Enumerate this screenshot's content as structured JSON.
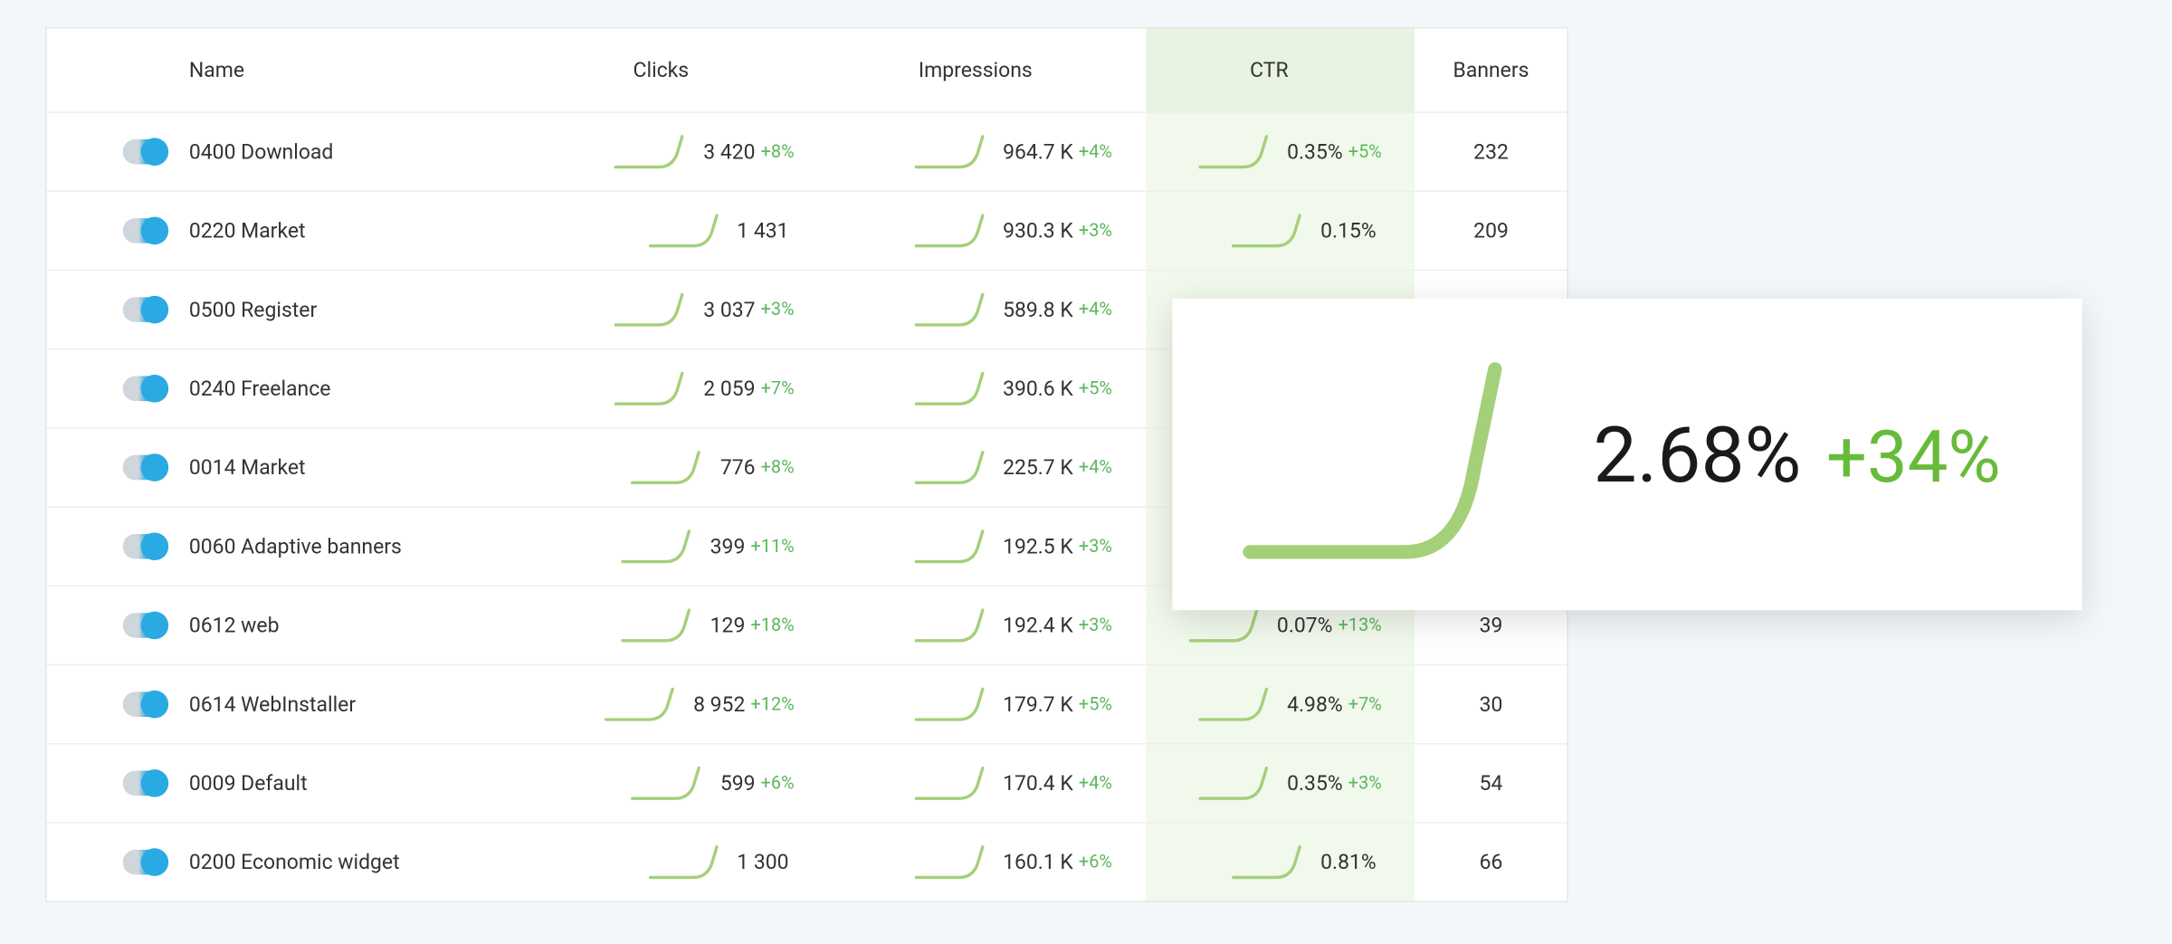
{
  "columns": {
    "name": "Name",
    "clicks": "Clicks",
    "impressions": "Impressions",
    "ctr": "CTR",
    "banners": "Banners"
  },
  "rows": [
    {
      "name": "0400 Download",
      "clicks": "3 420",
      "clicks_d": "+8%",
      "impr": "964.7 K",
      "impr_d": "+4%",
      "ctr": "0.35%",
      "ctr_d": "+5%",
      "banners": "232"
    },
    {
      "name": "0220 Market",
      "clicks": "1 431",
      "clicks_d": "",
      "impr": "930.3 K",
      "impr_d": "+3%",
      "ctr": "0.15%",
      "ctr_d": "",
      "banners": "209"
    },
    {
      "name": "0500 Register",
      "clicks": "3 037",
      "clicks_d": "+3%",
      "impr": "589.8 K",
      "impr_d": "+4%",
      "ctr": "",
      "ctr_d": "",
      "banners": ""
    },
    {
      "name": "0240 Freelance",
      "clicks": "2 059",
      "clicks_d": "+7%",
      "impr": "390.6 K",
      "impr_d": "+5%",
      "ctr": "",
      "ctr_d": "",
      "banners": ""
    },
    {
      "name": "0014 Market",
      "clicks": "776",
      "clicks_d": "+8%",
      "impr": "225.7 K",
      "impr_d": "+4%",
      "ctr": "",
      "ctr_d": "",
      "banners": ""
    },
    {
      "name": "0060 Adaptive banners",
      "clicks": "399",
      "clicks_d": "+11%",
      "impr": "192.5 K",
      "impr_d": "+3%",
      "ctr": "",
      "ctr_d": "",
      "banners": ""
    },
    {
      "name": "0612 web",
      "clicks": "129",
      "clicks_d": "+18%",
      "impr": "192.4 K",
      "impr_d": "+3%",
      "ctr": "0.07%",
      "ctr_d": "+13%",
      "banners": "39"
    },
    {
      "name": "0614 WebInstaller",
      "clicks": "8 952",
      "clicks_d": "+12%",
      "impr": "179.7 K",
      "impr_d": "+5%",
      "ctr": "4.98%",
      "ctr_d": "+7%",
      "banners": "30"
    },
    {
      "name": "0009 Default",
      "clicks": "599",
      "clicks_d": "+6%",
      "impr": "170.4 K",
      "impr_d": "+4%",
      "ctr": "0.35%",
      "ctr_d": "+3%",
      "banners": "54"
    },
    {
      "name": "0200 Economic widget",
      "clicks": "1 300",
      "clicks_d": "",
      "impr": "160.1 K",
      "impr_d": "+6%",
      "ctr": "0.81%",
      "ctr_d": "",
      "banners": "66"
    }
  ],
  "callout": {
    "value": "2.68%",
    "delta": "+34%"
  },
  "chart_data": {
    "type": "table",
    "title": "Campaign performance",
    "columns": [
      "Name",
      "Clicks",
      "Clicks Δ",
      "Impressions",
      "Impressions Δ",
      "CTR",
      "CTR Δ",
      "Banners"
    ],
    "rows": [
      [
        "0400 Download",
        3420,
        "+8%",
        "964.7 K",
        "+4%",
        "0.35%",
        "+5%",
        232
      ],
      [
        "0220 Market",
        1431,
        null,
        "930.3 K",
        "+3%",
        "0.15%",
        null,
        209
      ],
      [
        "0500 Register",
        3037,
        "+3%",
        "589.8 K",
        "+4%",
        null,
        null,
        null
      ],
      [
        "0240 Freelance",
        2059,
        "+7%",
        "390.6 K",
        "+5%",
        null,
        null,
        null
      ],
      [
        "0014 Market",
        776,
        "+8%",
        "225.7 K",
        "+4%",
        null,
        null,
        null
      ],
      [
        "0060 Adaptive banners",
        399,
        "+11%",
        "192.5 K",
        "+3%",
        null,
        null,
        null
      ],
      [
        "0612 web",
        129,
        "+18%",
        "192.4 K",
        "+3%",
        "0.07%",
        "+13%",
        39
      ],
      [
        "0614 WebInstaller",
        8952,
        "+12%",
        "179.7 K",
        "+5%",
        "4.98%",
        "+7%",
        30
      ],
      [
        "0009 Default",
        599,
        "+6%",
        "170.4 K",
        "+4%",
        "0.35%",
        "+3%",
        54
      ],
      [
        "0200 Economic widget",
        1300,
        null,
        "160.1 K",
        "+6%",
        "0.81%",
        null,
        66
      ]
    ],
    "highlight": {
      "metric": "CTR",
      "value": "2.68%",
      "delta": "+34%"
    }
  }
}
